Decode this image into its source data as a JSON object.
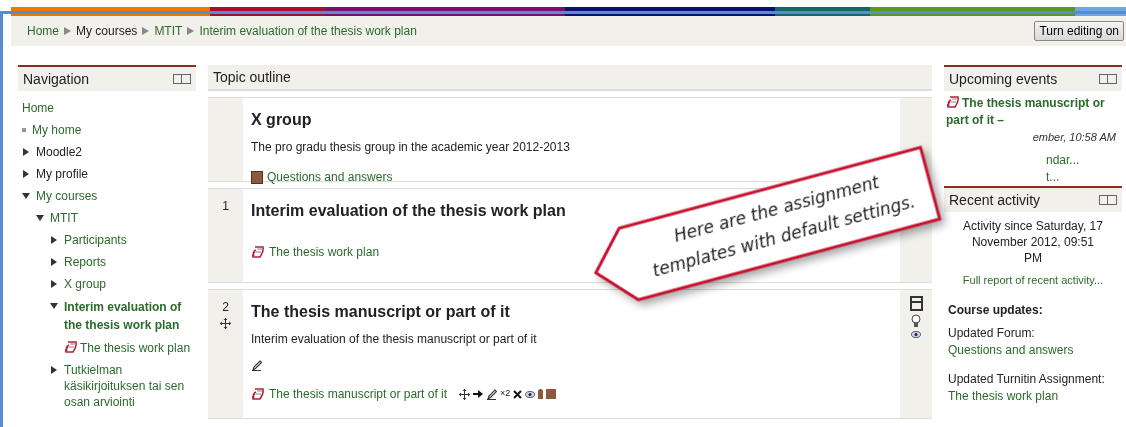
{
  "breadcrumb": [
    {
      "label": "Home",
      "kind": "link"
    },
    {
      "label": "My courses",
      "kind": "text"
    },
    {
      "label": "MTIT",
      "kind": "link"
    },
    {
      "label": "Interim evaluation of the thesis work plan",
      "kind": "link"
    }
  ],
  "editing_button": "Turn editing on",
  "navigation": {
    "title": "Navigation",
    "items": [
      {
        "label": "Home",
        "kind": "home",
        "current": false
      },
      {
        "label": "My home",
        "kind": "bullet",
        "current": false
      },
      {
        "label": "Moodle2",
        "kind": "branch",
        "expanded": false,
        "current": false
      },
      {
        "label": "My profile",
        "kind": "branch",
        "expanded": false,
        "current": false
      },
      {
        "label": "My courses",
        "kind": "branch",
        "expanded": true,
        "current": false,
        "children": [
          {
            "label": "MTIT",
            "kind": "branch",
            "expanded": true,
            "current": false,
            "children": [
              {
                "label": "Participants",
                "kind": "branch",
                "expanded": false,
                "current": false
              },
              {
                "label": "Reports",
                "kind": "branch",
                "expanded": false,
                "current": false
              },
              {
                "label": "X group",
                "kind": "branch",
                "expanded": false,
                "current": false
              },
              {
                "label": "Interim evaluation of the thesis work plan",
                "kind": "branch",
                "expanded": true,
                "current": true,
                "children": [
                  {
                    "label": "The thesis work plan",
                    "kind": "assignment",
                    "current": false
                  }
                ]
              },
              {
                "label": "Tutkielman käsikirjoituksen tai sen osan arviointi",
                "kind": "branch",
                "expanded": false,
                "current": false
              }
            ]
          }
        ]
      }
    ]
  },
  "topic_outline": {
    "title": "Topic outline",
    "sections": [
      {
        "title": "X group",
        "summary": "The pro gradu thesis group in the academic year 2012-2013",
        "editing": false,
        "items": [
          {
            "kind": "forum",
            "label": "Questions and answers",
            "edit_controls": false
          }
        ]
      },
      {
        "number": "1",
        "title": "Interim evaluation of the thesis work plan",
        "editing": false,
        "items": [
          {
            "kind": "assignment",
            "label": "The thesis work plan",
            "edit_controls": false
          }
        ]
      },
      {
        "number": "2",
        "title": "The thesis manuscript or part of it",
        "summary": "Interim evaluation of the thesis manuscript or part of it",
        "editing": true,
        "items": [
          {
            "kind": "edit",
            "edit_controls": false
          },
          {
            "kind": "assignment",
            "label": "The thesis manuscript or part of it",
            "edit_controls": true,
            "indent_label": "×2"
          }
        ]
      }
    ]
  },
  "upcoming_events": {
    "title": "Upcoming events",
    "event": "The thesis manuscript or",
    "event_line2": "part of it –",
    "date": "ember, 10:58 AM",
    "links": [
      "ndar...",
      "t..."
    ]
  },
  "recent_activity": {
    "title": "Recent activity",
    "since": "Activity since Saturday, 17 November 2012, 09:51 PM",
    "full_report": "Full report of recent activity...",
    "updates_title": "Course updates:",
    "updates": [
      {
        "label": "Updated Forum:",
        "link": "Questions and answers"
      },
      {
        "label": "Updated Turnitin Assignment:",
        "link": "The thesis work plan"
      }
    ]
  },
  "callout": {
    "text": "Here are the assignment templates with default settings."
  }
}
